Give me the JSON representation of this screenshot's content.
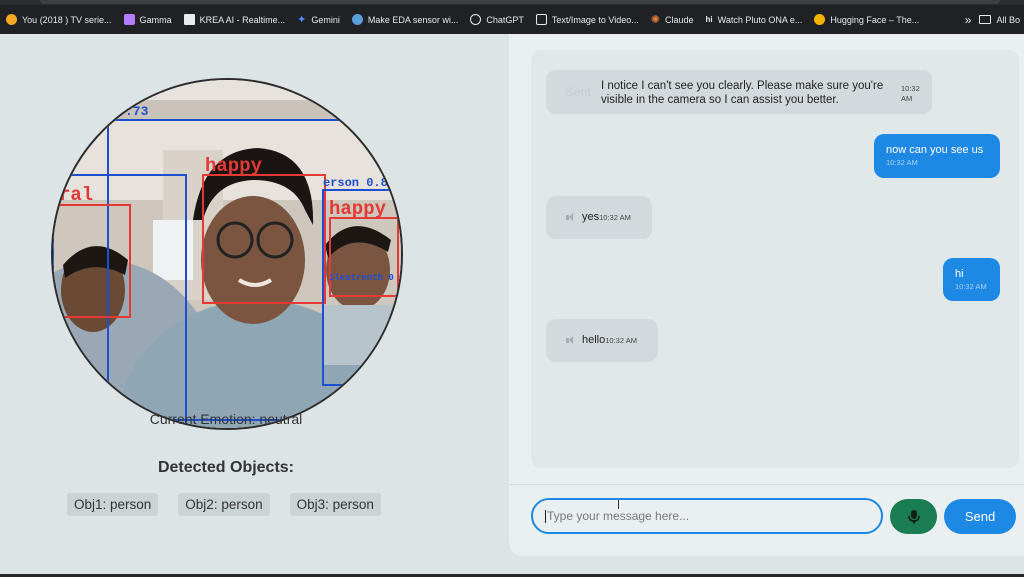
{
  "bookmarks": [
    {
      "label": "You (2018 ) TV serie...",
      "color": "#f5a623",
      "icon": "youtube-tv-icon"
    },
    {
      "label": "Gamma",
      "color": "#b57bff",
      "icon": "gamma-icon"
    },
    {
      "label": "KREA AI - Realtime...",
      "color": "#e8eaed",
      "icon": "krea-icon"
    },
    {
      "label": "Gemini",
      "color": "#4d8dff",
      "icon": "gemini-icon"
    },
    {
      "label": "Make EDA sensor wi...",
      "color": "#5aa0d8",
      "icon": "wordpress-icon"
    },
    {
      "label": "ChatGPT",
      "color": "#e8eaed",
      "icon": "chatgpt-icon"
    },
    {
      "label": "Text/Image to Video...",
      "color": "#e8eaed",
      "icon": "video-icon"
    },
    {
      "label": "Claude",
      "color": "#e07a3f",
      "icon": "claude-icon"
    },
    {
      "label": "Watch Pluto ONA e...",
      "color": "#e8eaed",
      "icon": "hianime-icon"
    },
    {
      "label": "Hugging Face – The...",
      "color": "#f4b400",
      "icon": "hugging-face-icon"
    }
  ],
  "bookmarks_more": "»",
  "bookmarks_all": "All Bo",
  "camera": {
    "detections": {
      "top_label": ".73",
      "happy_main": "happy",
      "happy_right": "happy",
      "neutral_left": "ral",
      "person_right": "erson 0.8",
      "bottom_right": "ilestrenth 0"
    }
  },
  "emotion_text": "Current Emotion: neutral",
  "detected_title": "Detected Objects:",
  "objects": [
    "Obj1: person",
    "Obj2: person",
    "Obj3: person"
  ],
  "messages": [
    {
      "role": "bot",
      "text": "I notice I can't see you clearly. Please make sure you're visible in the camera so I can assist you better.",
      "time": "10:32 AM",
      "ghost": "Sent"
    },
    {
      "role": "user",
      "text": "now can you see us",
      "time": "10:32 AM"
    },
    {
      "role": "bot",
      "text": "yes",
      "time": "10:32 AM"
    },
    {
      "role": "user",
      "text": "hi",
      "time": "10:32 AM"
    },
    {
      "role": "bot",
      "text": "hello",
      "time": "10:32 AM"
    }
  ],
  "input": {
    "placeholder": "Type your message here..."
  },
  "send_label": "Send",
  "colors": {
    "accent": "#1e88e5",
    "mic": "#1b7d52",
    "box_red": "#e53935",
    "box_blue": "#1f4fd1"
  }
}
